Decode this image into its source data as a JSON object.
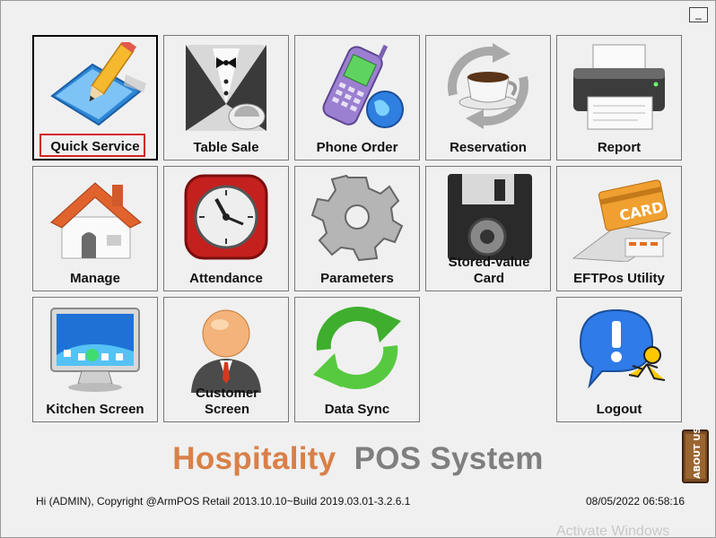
{
  "window": {
    "minimize_label": "_"
  },
  "tiles": [
    {
      "label": "Quick Service",
      "icon": "pencil-paper-icon"
    },
    {
      "label": "Table Sale",
      "icon": "waiter-tuxedo-icon"
    },
    {
      "label": "Phone Order",
      "icon": "phone-globe-icon"
    },
    {
      "label": "Reservation",
      "icon": "coffee-cup-cycle-icon"
    },
    {
      "label": "Report",
      "icon": "printer-icon"
    },
    {
      "label": "Manage",
      "icon": "house-icon"
    },
    {
      "label": "Attendance",
      "icon": "clock-icon"
    },
    {
      "label": "Parameters",
      "icon": "gear-icon"
    },
    {
      "label": "Stored-value Card",
      "icon": "floppy-disk-icon"
    },
    {
      "label": "EFTPos Utility",
      "icon": "card-terminal-icon"
    },
    {
      "label": "Kitchen Screen",
      "icon": "monitor-icon"
    },
    {
      "label": "Customer Screen",
      "icon": "customer-person-icon"
    },
    {
      "label": "Data Sync",
      "icon": "sync-arrows-icon"
    },
    {
      "label": "Logout",
      "icon": "logout-runner-icon"
    }
  ],
  "brand": {
    "word1": "Hospitality",
    "word2": "POS System"
  },
  "footer": {
    "copyright": "Hi (ADMIN), Copyright @ArmPOS Retail 2013.10.10~Build 2019.03.01-3.2.6.1",
    "datetime": "08/05/2022 06:58:16"
  },
  "about_label": "ABOUT US",
  "watermark": "Activate Windows",
  "colors": {
    "brand_orange": "#d98048",
    "brand_gray": "#7f7f7f",
    "selected_outline": "#d32424"
  }
}
